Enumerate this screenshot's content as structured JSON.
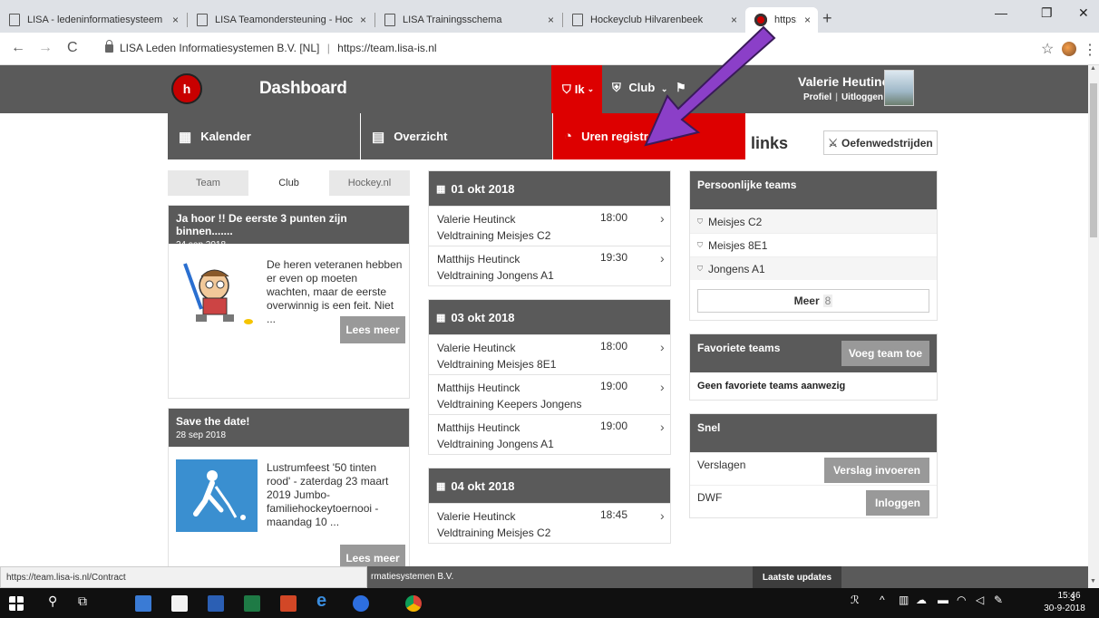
{
  "browser": {
    "tabs": [
      {
        "title": "LISA - ledeninformatiesysteem",
        "close": "×"
      },
      {
        "title": "LISA Teamondersteuning - Hoc",
        "close": "×"
      },
      {
        "title": "LISA Trainingsschema",
        "close": "×"
      },
      {
        "title": "Hockeyclub Hilvarenbeek",
        "close": "×"
      },
      {
        "title": "https://team.lisa-is.nl",
        "close": "×"
      }
    ],
    "new_tab": "+",
    "site_identity": "LISA Leden Informatiesystemen B.V. [NL]",
    "url": "https://team.lisa-is.nl",
    "status_url": "https://team.lisa-is.nl/Contract"
  },
  "header": {
    "logo_text": "h",
    "title": "Dashboard",
    "nav_ik": "Ik",
    "nav_club": "Club",
    "user_name": "Valerie Heutinck",
    "profile_link": "Profiel",
    "logout_link": "Uitloggen"
  },
  "subnav": {
    "kalender": "Kalender",
    "overzicht": "Overzicht",
    "uren": "Uren registreren"
  },
  "links_title": "links",
  "oefen_button": "Oefenwedstrijden",
  "news_tabs": [
    "Team",
    "Club",
    "Hockey.nl"
  ],
  "news": [
    {
      "title": "Ja hoor !! De eerste 3 punten zijn binnen.......",
      "date": "24 sep 2018",
      "text": "De heren veteranen hebben er even op moeten wachten, maar de eerste overwinnig is een feit. Niet ...",
      "button": "Lees meer"
    },
    {
      "title": "Save the date!",
      "date": "28 sep 2018",
      "text": "Lustrumfeest '50 tinten rood' - zaterdag 23 maart 2019 Jumbo-familiehockeytoernooi - maandag 10 ...",
      "button": "Lees meer"
    }
  ],
  "agenda": [
    {
      "date": "01 okt 2018",
      "events": [
        {
          "name": "Valerie Heutinck",
          "sub": "Veldtraining Meisjes C2",
          "time": "18:00"
        },
        {
          "name": "Matthijs Heutinck",
          "sub": "Veldtraining Jongens A1",
          "time": "19:30"
        }
      ]
    },
    {
      "date": "03 okt 2018",
      "events": [
        {
          "name": "Valerie Heutinck",
          "sub": "Veldtraining Meisjes 8E1",
          "time": "18:00"
        },
        {
          "name": "Matthijs Heutinck",
          "sub": "Veldtraining Keepers Jongens",
          "time": "19:00"
        },
        {
          "name": "Matthijs Heutinck",
          "sub": "Veldtraining Jongens A1",
          "time": "19:00"
        }
      ]
    },
    {
      "date": "04 okt 2018",
      "events": [
        {
          "name": "Valerie Heutinck",
          "sub": "Veldtraining Meisjes C2",
          "time": "18:45"
        }
      ]
    }
  ],
  "personal_teams": {
    "title": "Persoonlijke teams",
    "teams": [
      "Meisjes C2",
      "Meisjes 8E1",
      "Jongens A1"
    ],
    "more_label": "Meer",
    "more_count": "8"
  },
  "favorite_teams": {
    "title": "Favoriete teams",
    "add_button": "Voeg team toe",
    "empty_text": "Geen favoriete teams aanwezig"
  },
  "snel": {
    "title": "Snel",
    "rows": [
      {
        "label": "Verslagen",
        "button": "Verslag invoeren"
      },
      {
        "label": "DWF",
        "button": "Inloggen"
      }
    ]
  },
  "footer": {
    "text": "rmatiesystemen B.V.",
    "latest": "Laatste updates"
  },
  "taskbar": {
    "time": "15:46",
    "date": "30-9-2018",
    "notifications": "3"
  },
  "colors": {
    "header_gray": "#5a5a5a",
    "accent_red": "#dd0000",
    "annotation_purple": "#8b3fc8"
  }
}
